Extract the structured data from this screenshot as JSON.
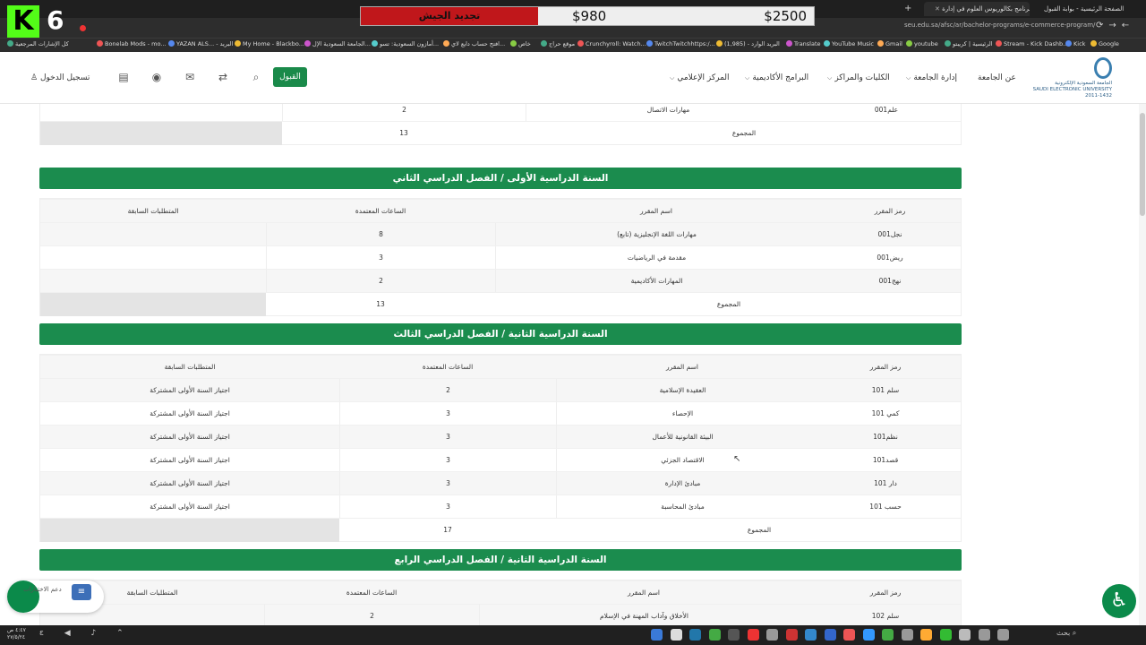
{
  "browser": {
    "tabs": [
      {
        "title": "الصفحة الرئيسية - بوابة القبول",
        "active": false
      },
      {
        "title": "برنامج بكالوريوس العلوم في إدارة...",
        "active": true
      }
    ],
    "url": "seu.edu.sa/afsc/ar/bachelor-programs/e-commerce-program/",
    "bookmarks": [
      "كل الإشارات المرجعية",
      "Bonelab Mods - mo...",
      "YAZAN ALS... - البريد",
      "My Home - Blackbo...",
      "الجامعة السعودية الإل...",
      "أمازون السعودية: تسو...",
      "افتح حساب دايع لاي...",
      "خاص",
      "موقع حراج",
      "Crunchyroll: Watch...",
      "TwitchTwitchhttps:/...",
      "البريد الوارد - (1,985)",
      "Translate",
      "YouTube Music",
      "Gmail",
      "youtube",
      "الرئيسية | كريبتو",
      "Stream - Kick Dashb...",
      "Kick",
      "Google"
    ]
  },
  "overlay": {
    "label": "تجديد الجيش",
    "value1": "$980",
    "value2": "$2500"
  },
  "stream_badge": {
    "letter": "K",
    "number": "6"
  },
  "nav": {
    "logo_ar": "الجامعة السعودية الإلكترونية",
    "logo_en": "SAUDI ELECTRONIC UNIVERSITY",
    "logo_year": "2011-1432",
    "links": [
      "عن الجامعة",
      "إدارة الجامعة",
      "الكليات والمراكز",
      "البرامج الأكاديمية",
      "المركز الإعلامي"
    ],
    "apply": "القبول",
    "login": "تسجيل الدخول"
  },
  "sections": [
    {
      "title": "",
      "headers": [],
      "rows": [
        {
          "code": "علم001",
          "name": "مهارات الاتصال",
          "hours": "2",
          "prereq": ""
        }
      ],
      "total_label": "المجموع",
      "total": "13"
    },
    {
      "title": "السنة الدراسية الأولى / الفصل الدراسي الثاني",
      "headers": [
        "رمز المقرر",
        "اسم المقرر",
        "الساعات المعتمدة",
        "المتطلبات السابقة"
      ],
      "rows": [
        {
          "code": "نجل001",
          "name": "مهارات اللغة الإنجليزية (تابع)",
          "hours": "8",
          "prereq": ""
        },
        {
          "code": "ريض001",
          "name": "مقدمة في الرياضيات",
          "hours": "3",
          "prereq": ""
        },
        {
          "code": "نهج001",
          "name": "المهارات الأكاديمية",
          "hours": "2",
          "prereq": ""
        }
      ],
      "total_label": "المجموع",
      "total": "13"
    },
    {
      "title": "السنة الدراسية الثانية / الفصل الدراسي الثالث",
      "headers": [
        "رمز المقرر",
        "اسم المقرر",
        "الساعات المعتمدة",
        "المتطلبات السابقة"
      ],
      "rows": [
        {
          "code": "سلم 101",
          "name": "العقيدة الإسلامية",
          "hours": "2",
          "prereq": "اجتياز السنة الأولى المشتركة"
        },
        {
          "code": "كمي 101",
          "name": "الإحصاء",
          "hours": "3",
          "prereq": "اجتياز السنة الأولى المشتركة"
        },
        {
          "code": "نظم101",
          "name": "البيئة القانونية للأعمال",
          "hours": "3",
          "prereq": "اجتياز السنة الأولى المشتركة"
        },
        {
          "code": "قصد101",
          "name": "الاقتصاد الجزئي",
          "hours": "3",
          "prereq": "اجتياز السنة الأولى المشتركة"
        },
        {
          "code": "دار 101",
          "name": "مبادئ الإدارة",
          "hours": "3",
          "prereq": "اجتياز السنة الأولى المشتركة"
        },
        {
          "code": "حسب 101",
          "name": "مبادئ المحاسبة",
          "hours": "3",
          "prereq": "اجتياز السنة الأولى المشتركة"
        }
      ],
      "total_label": "المجموع",
      "total": "17"
    },
    {
      "title": "السنة الدراسية الثانية / الفصل الدراسي الرابع",
      "headers": [
        "رمز المقرر",
        "اسم المقرر",
        "الساعات المعتمدة",
        "المتطلبات السابقة"
      ],
      "rows": [
        {
          "code": "سلم 102",
          "name": "الأخلاق وآداب المهنة في الإسلام",
          "hours": "2",
          "prereq": ""
        }
      ]
    }
  ],
  "help": {
    "label": "دعم الاختبارات"
  },
  "taskbar": {
    "time": "٤:٤٧ ص",
    "date": "٢٧/٥/٢٤",
    "search": "بحث"
  },
  "colors": {
    "green": "#1b8c4e",
    "overlay_red": "#c0171b",
    "kick_green": "#53fc18"
  }
}
